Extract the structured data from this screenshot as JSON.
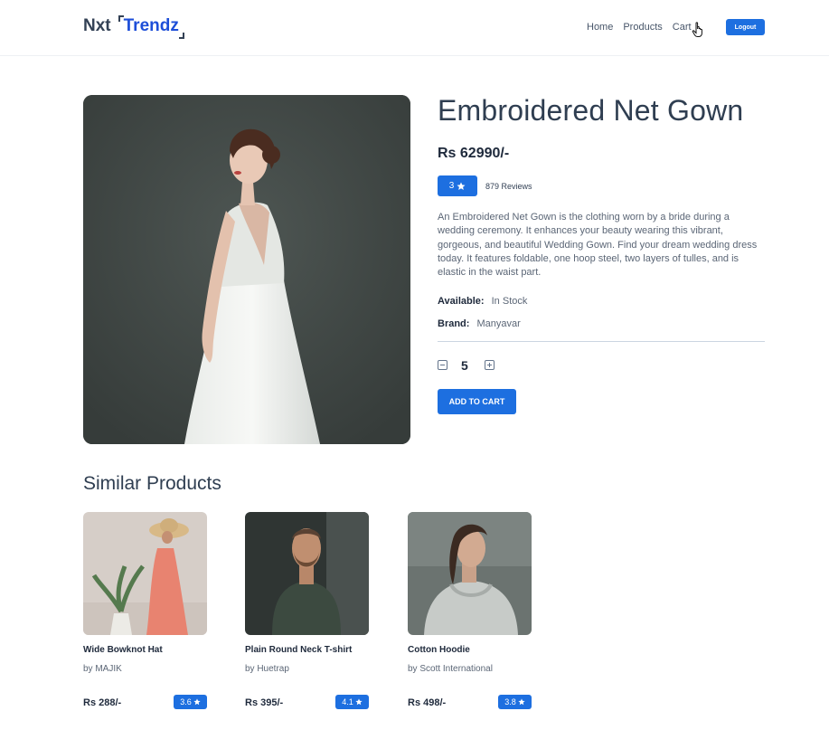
{
  "header": {
    "logo_part1": "Nxt",
    "logo_part2": "Trendz",
    "nav": [
      "Home",
      "Products",
      "Cart"
    ],
    "logout_label": "Logout"
  },
  "product": {
    "title": "Embroidered Net Gown",
    "price": "Rs 62990/-",
    "rating": "3",
    "reviews": "879 Reviews",
    "description": "An Embroidered Net Gown is the clothing worn by a bride during a wedding ceremony. It enhances your beauty wearing this vibrant, gorgeous, and beautiful Wedding Gown. Find your dream wedding dress today. It features foldable, one hoop steel, two layers of tulles, and is elastic in the waist part.",
    "available_label": "Available:",
    "available_value": "In Stock",
    "brand_label": "Brand:",
    "brand_value": "Manyavar",
    "quantity": "5",
    "add_to_cart_label": "ADD TO CART"
  },
  "similar": {
    "title": "Similar Products",
    "items": [
      {
        "name": "Wide Bowknot Hat",
        "brand": "by MAJIK",
        "price": "Rs 288/-",
        "rating": "3.6"
      },
      {
        "name": "Plain Round Neck T-shirt",
        "brand": "by Huetrap",
        "price": "Rs 395/-",
        "rating": "4.1"
      },
      {
        "name": "Cotton Hoodie",
        "brand": "by Scott International",
        "price": "Rs 498/-",
        "rating": "3.8"
      }
    ]
  },
  "icons": {
    "star": "star-icon",
    "minus": "minus-square-icon",
    "plus": "plus-square-icon",
    "cursor": "hand-pointer-icon"
  },
  "colors": {
    "accent": "#1d6fe0",
    "heading": "#2f3e51",
    "text_muted": "#5b6676"
  }
}
